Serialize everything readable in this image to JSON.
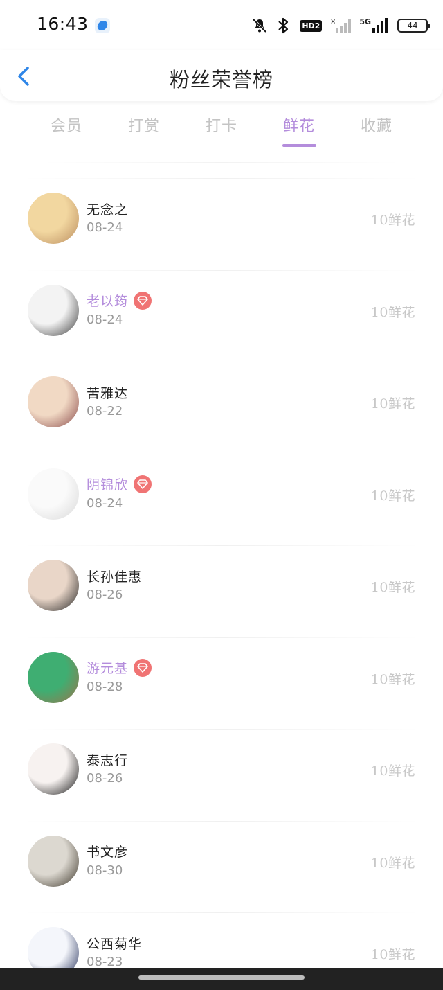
{
  "status_bar": {
    "time": "16:43",
    "hd_label": "HD2",
    "network_label": "5G",
    "battery": "44",
    "icons": [
      "app-icon",
      "mute-bell-icon",
      "bluetooth-icon",
      "hd-icon",
      "signal-weak-icon",
      "signal-5g-icon",
      "battery-icon"
    ]
  },
  "header": {
    "title": "粉丝荣誉榜",
    "back_icon": "chevron-left-icon"
  },
  "tabs": [
    {
      "label": "会员",
      "active": false
    },
    {
      "label": "打赏",
      "active": false
    },
    {
      "label": "打卡",
      "active": false
    },
    {
      "label": "鲜花",
      "active": true
    },
    {
      "label": "收藏",
      "active": false
    }
  ],
  "colors": {
    "accent": "#b48ddc",
    "vip_badge": "#f07474",
    "back_arrow": "#2f86e8",
    "muted": "#c8c8c8"
  },
  "fans": [
    {
      "name": "无念之",
      "date": "08-24",
      "count": "10鲜花",
      "vip": false,
      "avatar_colors": [
        "#f2d7a0",
        "#b98b5d"
      ]
    },
    {
      "name": "老以筠",
      "date": "08-24",
      "count": "10鲜花",
      "vip": true,
      "avatar_colors": [
        "#f3f3f3",
        "#3a3a3a"
      ]
    },
    {
      "name": "苦雅达",
      "date": "08-22",
      "count": "10鲜花",
      "vip": false,
      "avatar_colors": [
        "#f1d9c4",
        "#8a4a4a"
      ]
    },
    {
      "name": "阴锦欣",
      "date": "08-24",
      "count": "10鲜花",
      "vip": true,
      "avatar_colors": [
        "#fafafa",
        "#d8d8d8"
      ]
    },
    {
      "name": "长孙佳惠",
      "date": "08-26",
      "count": "10鲜花",
      "vip": false,
      "avatar_colors": [
        "#e9d6c8",
        "#222222"
      ]
    },
    {
      "name": "游元基",
      "date": "08-28",
      "count": "10鲜花",
      "vip": true,
      "avatar_colors": [
        "#3fae72",
        "#a0714a"
      ]
    },
    {
      "name": "泰志行",
      "date": "08-26",
      "count": "10鲜花",
      "vip": false,
      "avatar_colors": [
        "#f7f2f0",
        "#111111"
      ]
    },
    {
      "name": "书文彦",
      "date": "08-30",
      "count": "10鲜花",
      "vip": false,
      "avatar_colors": [
        "#dcd8d0",
        "#3b3428"
      ]
    },
    {
      "name": "公西菊华",
      "date": "08-23",
      "count": "10鲜花",
      "vip": false,
      "avatar_colors": [
        "#f4f6fb",
        "#1e2a55"
      ]
    }
  ]
}
